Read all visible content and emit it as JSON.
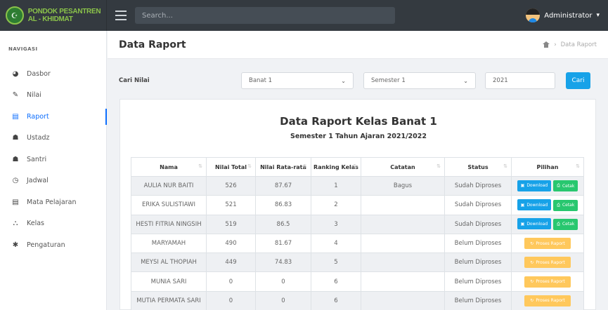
{
  "header": {
    "brand_line1": "PONDOK PESANTREN",
    "brand_line2": "AL - KHIDMAT",
    "search_placeholder": "Search...",
    "user_name": "Administrator"
  },
  "sidebar": {
    "heading": "NAVIGASI",
    "items": [
      {
        "label": "Dasbor",
        "icon": "dashboard-icon"
      },
      {
        "label": "Nilai",
        "icon": "edit-icon"
      },
      {
        "label": "Raport",
        "icon": "book-icon",
        "active": true
      },
      {
        "label": "Ustadz",
        "icon": "users-icon"
      },
      {
        "label": "Santri",
        "icon": "users-icon"
      },
      {
        "label": "Jadwal",
        "icon": "clock-icon"
      },
      {
        "label": "Mata Pelajaran",
        "icon": "book-icon"
      },
      {
        "label": "Kelas",
        "icon": "sitemap-icon"
      },
      {
        "label": "Pengaturan",
        "icon": "gear-icon"
      }
    ]
  },
  "page": {
    "title": "Data Raport",
    "breadcrumb_current": "Data Raport"
  },
  "filter": {
    "label": "Cari Nilai",
    "kelas_value": "Banat 1",
    "semester_value": "Semester 1",
    "year_value": "2021",
    "search_button": "Cari"
  },
  "report": {
    "title": "Data Raport Kelas Banat 1",
    "subtitle": "Semester 1 Tahun Ajaran 2021/2022",
    "columns": [
      "Nama",
      "Nilai Total",
      "Nilai Rata-rata",
      "Ranking Kelas",
      "Catatan",
      "Status",
      "Pilihan"
    ],
    "rows": [
      {
        "nama": "AULIA NUR BAITI",
        "total": "526",
        "rata": "87.67",
        "ranking": "1",
        "catatan": "Bagus",
        "status": "Sudah Diproses",
        "processed": true
      },
      {
        "nama": "ERIKA SULISTIAWI",
        "total": "521",
        "rata": "86.83",
        "ranking": "2",
        "catatan": "",
        "status": "Sudah Diproses",
        "processed": true
      },
      {
        "nama": "HESTI FITRIA NINGSIH",
        "total": "519",
        "rata": "86.5",
        "ranking": "3",
        "catatan": "",
        "status": "Sudah Diproses",
        "processed": true
      },
      {
        "nama": "MARYAMAH",
        "total": "490",
        "rata": "81.67",
        "ranking": "4",
        "catatan": "",
        "status": "Belum Diproses",
        "processed": false
      },
      {
        "nama": "MEYSI AL THOPIAH",
        "total": "449",
        "rata": "74.83",
        "ranking": "5",
        "catatan": "",
        "status": "Belum Diproses",
        "processed": false
      },
      {
        "nama": "MUNIA SARI",
        "total": "0",
        "rata": "0",
        "ranking": "6",
        "catatan": "",
        "status": "Belum Diproses",
        "processed": false
      },
      {
        "nama": "MUTIA PERMATA SARI",
        "total": "0",
        "rata": "0",
        "ranking": "6",
        "catatan": "",
        "status": "Belum Diproses",
        "processed": false
      }
    ],
    "download_label": "Download",
    "cetak_label": "Cetak",
    "proses_label": "Proses Raport"
  },
  "colors": {
    "topbar": "#343a40",
    "accent": "#0d6efd",
    "info": "#17a2e8",
    "success": "#28c76f",
    "warning": "#ffc85c"
  }
}
